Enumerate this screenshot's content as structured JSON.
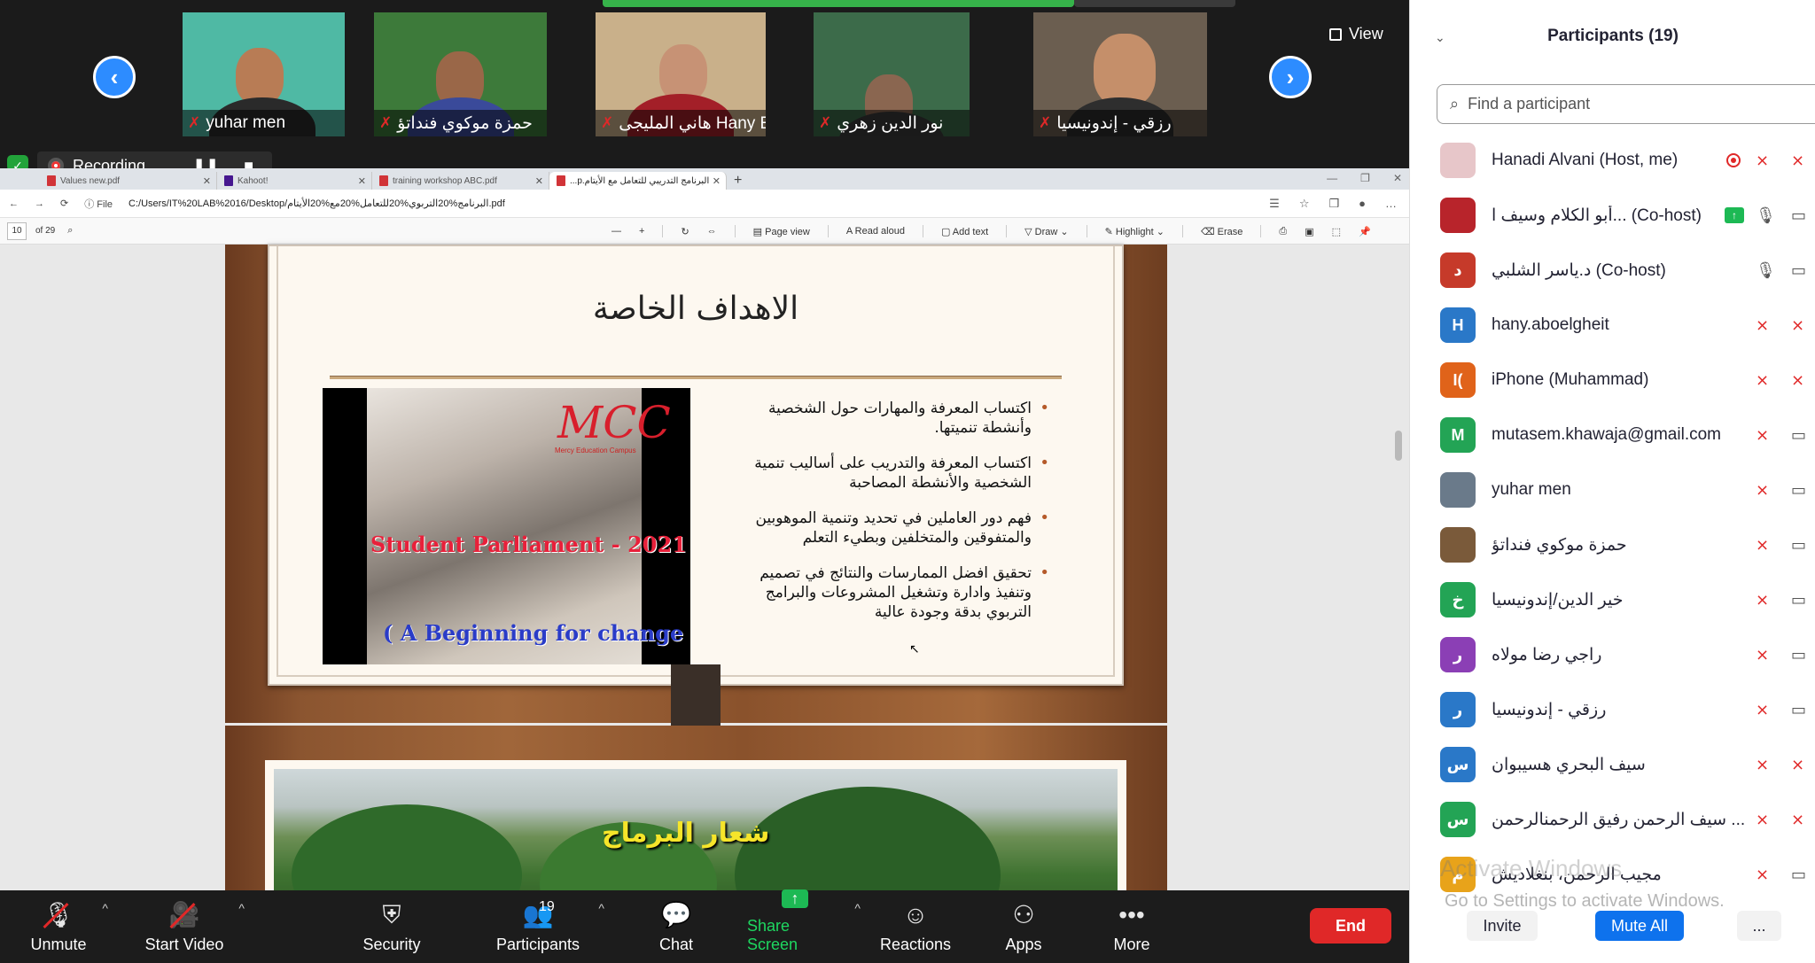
{
  "thumbnails": [
    {
      "name": "yuhar men",
      "bg": "#4fb9a4",
      "skin": "#b87c55",
      "shirt": "#2a2a2a"
    },
    {
      "name": "حمزة موكوي فنداتؤ",
      "bg": "#3d7a3a",
      "skin": "#9a6748",
      "shirt": "#3a4a9a"
    },
    {
      "name": "هاني المليجى Hany El...",
      "bg": "#c9b08a",
      "skin": "#c79275",
      "shirt": "#a31f28"
    },
    {
      "name": "نور الدين زهري",
      "bg": "#3c6b4a",
      "skin": "#8a6650",
      "shirt": "#3b3b3b"
    },
    {
      "name": "رزقي - إندونيسيا",
      "bg": "#6b5e50",
      "skin": "#c58f6a",
      "shirt": "#2e2e2e"
    }
  ],
  "view_label": "View",
  "recording_label": "Recording...",
  "browser": {
    "tabs": [
      {
        "label": "Values new.pdf",
        "active": false
      },
      {
        "label": "Kahoot!",
        "active": false
      },
      {
        "label": "training workshop ABC.pdf",
        "active": false
      },
      {
        "label": "البرنامج التدريبي للتعامل مع الأيتام.p...",
        "active": true
      }
    ],
    "file_label": "File",
    "url": "C:/Users/IT%20LAB%2016/Desktop/البرنامج%20التربوي%20للتعامل%20مع%20الأيتام.pdf",
    "page_current": "10",
    "page_total": "of 29",
    "tools": {
      "page_view": "Page view",
      "read_aloud": "Read aloud",
      "add_text": "Add text",
      "draw": "Draw",
      "highlight": "Highlight",
      "erase": "Erase"
    }
  },
  "slide1": {
    "title": "الاهداف الخاصة",
    "photo_title": "Student Parliament - 2021",
    "photo_subtitle": "( A Beginning for change )",
    "photo_logo": "MCC",
    "photo_logo_sub": "Mercy Education Campus",
    "bullets": [
      "اكتساب المعرفة والمهارات حول الشخصية وأنشطة تنميتها.",
      "اكتساب المعرفة والتدريب على أساليب تنمية الشخصية والأنشطة المصاحبة",
      "فهم دور العاملين في تحديد وتنمية الموهوبين والمتفوقين والمتخلفين وبطيء التعلم",
      "تحقيق افضل الممارسات والنتائج في تصميم وتنفيذ وادارة وتشغيل المشروعات والبرامج التربوي بدقة وجودة عالية"
    ]
  },
  "slide2": {
    "title": "شعار البرماج"
  },
  "toolbar": {
    "unmute": "Unmute",
    "start_video": "Start Video",
    "security": "Security",
    "participants": "Participants",
    "participants_count": "19",
    "chat": "Chat",
    "share_screen": "Share Screen",
    "reactions": "Reactions",
    "apps": "Apps",
    "more": "More",
    "end": "End"
  },
  "panel": {
    "title": "Participants (19)",
    "search_placeholder": "Find a participant",
    "participants": [
      {
        "name": "Hanadi Alvani (Host, me)",
        "initial": "",
        "color": "#e7c6c9",
        "mic": "off",
        "cam": "off",
        "extra": "rec"
      },
      {
        "name": "أبو الكلام وسيف ا... (Co-host)",
        "initial": "",
        "color": "#b8242b",
        "mic": "on",
        "cam": "on",
        "extra": "share"
      },
      {
        "name": "د.ياسر الشلبي (Co-host)",
        "initial": "د",
        "color": "#c63a2a",
        "mic": "on",
        "cam": "on",
        "extra": ""
      },
      {
        "name": "hany.aboelgheit",
        "initial": "H",
        "color": "#2a78c8",
        "mic": "off",
        "cam": "off",
        "extra": ""
      },
      {
        "name": "iPhone (Muhammad)",
        "initial": "I(",
        "color": "#e0631a",
        "mic": "off",
        "cam": "off",
        "extra": ""
      },
      {
        "name": "mutasem.khawaja@gmail.com",
        "initial": "M",
        "color": "#23a455",
        "mic": "off",
        "cam": "on",
        "extra": ""
      },
      {
        "name": "yuhar men",
        "initial": "",
        "color": "#6a7a8a",
        "mic": "off",
        "cam": "on",
        "extra": ""
      },
      {
        "name": "حمزة موكوي فنداتؤ",
        "initial": "",
        "color": "#7a5a3a",
        "mic": "off",
        "cam": "on",
        "extra": ""
      },
      {
        "name": "خير الدين/إندونيسيا",
        "initial": "خ",
        "color": "#23a455",
        "mic": "off",
        "cam": "on",
        "extra": ""
      },
      {
        "name": "راجي رضا مولاه",
        "initial": "ر",
        "color": "#8b3fb5",
        "mic": "off",
        "cam": "on",
        "extra": ""
      },
      {
        "name": "رزقي - إندونيسيا",
        "initial": "ر",
        "color": "#2a78c8",
        "mic": "off",
        "cam": "on",
        "extra": ""
      },
      {
        "name": "سيف البحري هسيبوان",
        "initial": "س",
        "color": "#2a78c8",
        "mic": "off",
        "cam": "off",
        "extra": ""
      },
      {
        "name": "سيف الرحمن رفيق الرحمنالرحمن ...",
        "initial": "س",
        "color": "#23a455",
        "mic": "off",
        "cam": "off",
        "extra": ""
      },
      {
        "name": "مجيب الرحمن، بنغلاديش",
        "initial": "م",
        "color": "#e8a31a",
        "mic": "off",
        "cam": "on",
        "extra": ""
      }
    ],
    "watermark_title": "Activate Windows",
    "watermark_sub": "Go to Settings to activate Windows.",
    "invite": "Invite",
    "mute_all": "Mute All",
    "more": "..."
  }
}
